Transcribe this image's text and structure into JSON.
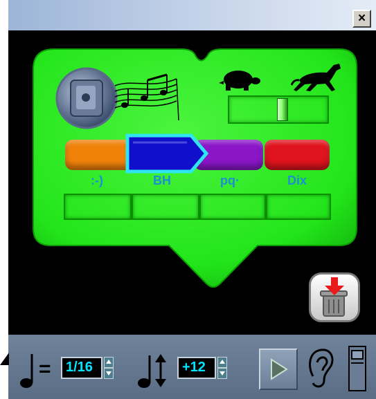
{
  "window": {
    "close_label": "×"
  },
  "tracks": [
    {
      "label": ":-)",
      "color": "#f0820a"
    },
    {
      "label": "BH",
      "color": "#1010cc"
    },
    {
      "label": "pq·",
      "color": "#8a16c8"
    },
    {
      "label": "Dix",
      "color": "#e0141e"
    }
  ],
  "colors": {
    "panel": "#22e41a",
    "panel_dark": "#0a8f00",
    "digit": "#00e5ff",
    "selection": "#2ee5f0"
  },
  "icons": {
    "speaker": "speaker-music-icon",
    "turtle": "turtle-icon",
    "horse": "horse-icon",
    "trash": "trash-icon",
    "note": "quarter-note-icon",
    "transpose": "transpose-icon",
    "play": "play-icon",
    "ear": "ear-icon"
  },
  "controls": {
    "note_equals": "=",
    "note_value": "1/16",
    "transpose_value": "+12",
    "speed_fraction": 0.55
  }
}
